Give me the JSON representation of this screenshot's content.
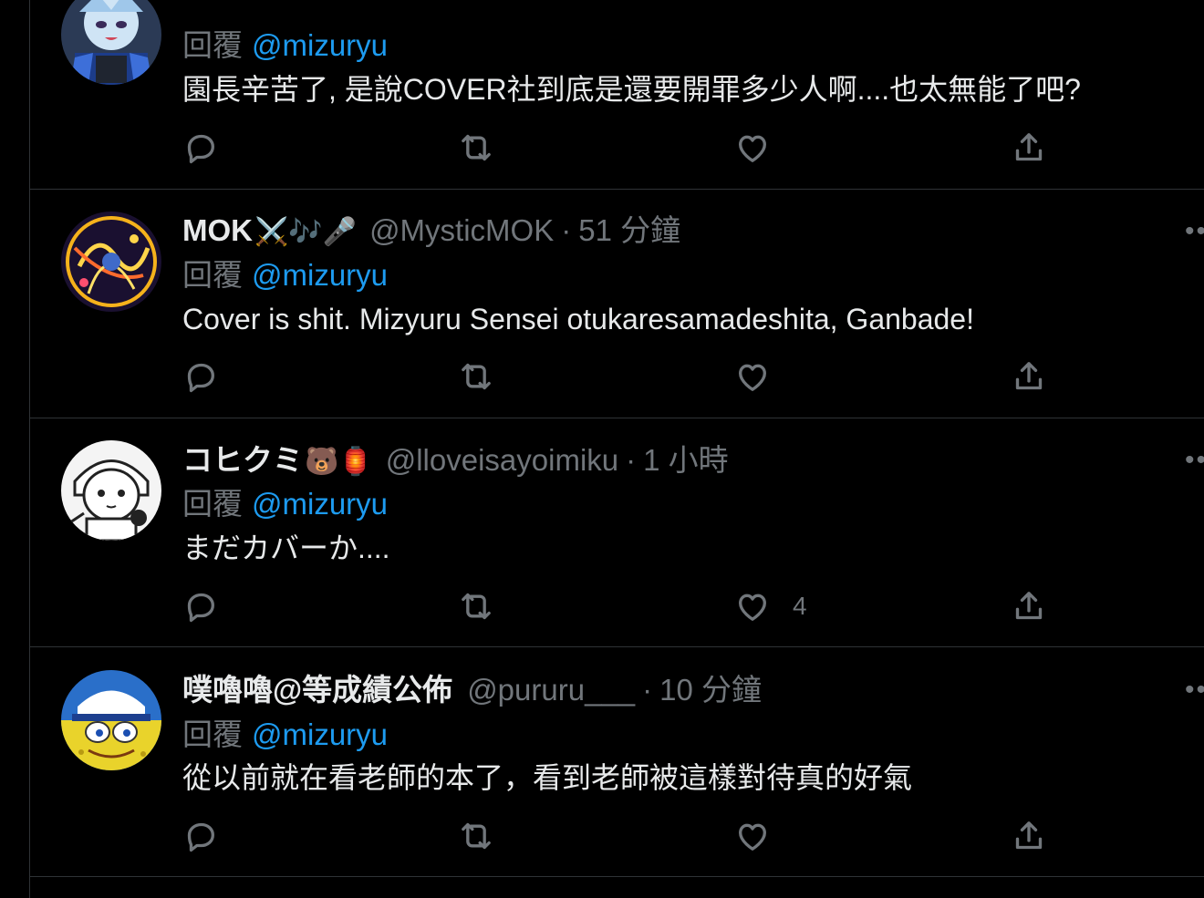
{
  "tweets": [
    {
      "name": "",
      "name_emoji": "",
      "handle": "",
      "time": "",
      "reply_label": "回覆",
      "reply_to": "@mizuryu",
      "text": "園長辛苦了, 是說COVER社到底是還要開罪多少人啊....也太無能了吧?",
      "like_count": ""
    },
    {
      "name": "MOK",
      "name_emoji": "⚔️🎶🎤",
      "handle": "@MysticMOK",
      "time": "51 分鐘",
      "reply_label": "回覆",
      "reply_to": "@mizuryu",
      "text": "Cover is shit. Mizyuru Sensei otukaresamadeshita, Ganbade!",
      "like_count": ""
    },
    {
      "name": "コヒクミ",
      "name_emoji": "🐻🏮",
      "handle": "@lloveisayoimiku",
      "time": "1 小時",
      "reply_label": "回覆",
      "reply_to": "@mizuryu",
      "text": "まだカバーか....",
      "like_count": "4"
    },
    {
      "name": "噗嚕嚕@等成績公佈",
      "name_emoji": "",
      "handle": "@pururu___",
      "time": "10 分鐘",
      "reply_label": "回覆",
      "reply_to": "@mizuryu",
      "text": "從以前就在看老師的本了，看到老師被這樣對待真的好氣",
      "like_count": ""
    }
  ],
  "separator": "·",
  "icons": {
    "reply": "reply-icon",
    "retweet": "retweet-icon",
    "like": "heart-icon",
    "share": "share-icon",
    "more": "more-icon"
  },
  "colors": {
    "background": "#000000",
    "text": "#e7e9ea",
    "secondary": "#71767b",
    "mention": "#1d9bf0",
    "border": "#2f3336"
  }
}
